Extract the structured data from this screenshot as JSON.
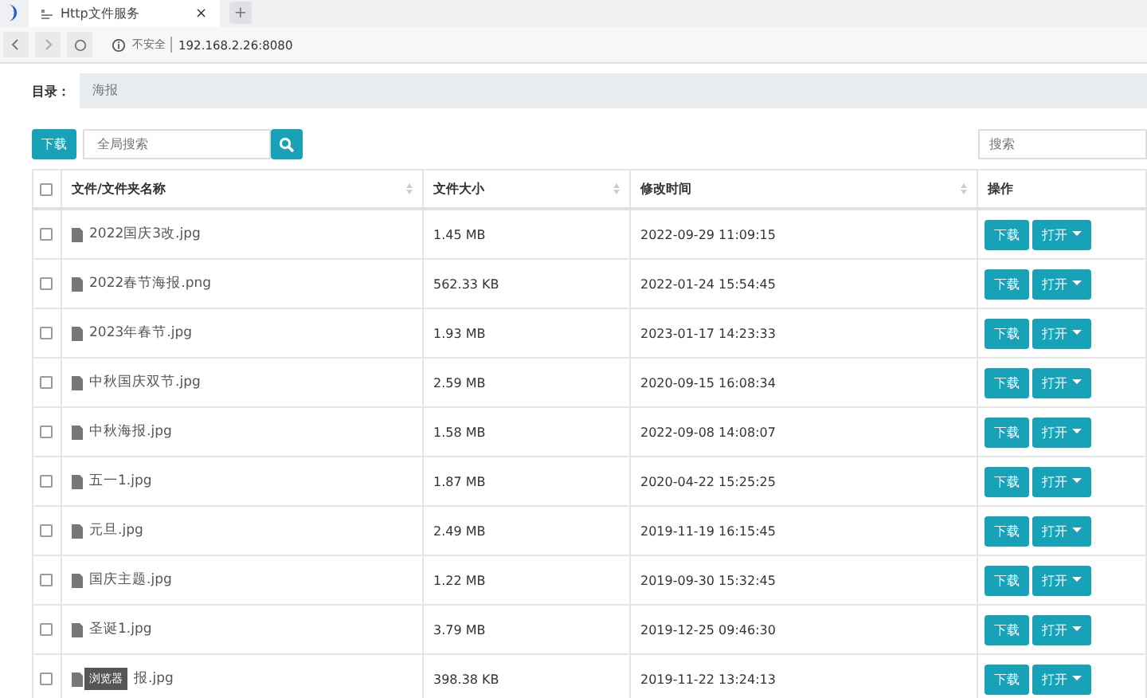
{
  "browser": {
    "tab": {
      "title": "Http文件服务",
      "close": "×"
    },
    "new_tab": "+",
    "security": "不安全",
    "address": "192.168.2.26:8080"
  },
  "directory": {
    "label": "目录：",
    "path": "海报"
  },
  "toolbar": {
    "download": "下载",
    "global_search_placeholder": "全局搜索",
    "search_placeholder": "搜索"
  },
  "table": {
    "header_checked": false,
    "columns": [
      {
        "label": "文件/文件夹名称",
        "sortable": true
      },
      {
        "label": "文件大小",
        "sortable": true
      },
      {
        "label": "修改时间",
        "sortable": true
      },
      {
        "label": "操作",
        "sortable": false
      }
    ],
    "rows": [
      {
        "checked": false,
        "name": "2022国庆3改.jpg",
        "size": "1.45 MB",
        "modified": "2022-09-29 11:09:15",
        "download": "下载",
        "open": "打开"
      },
      {
        "checked": false,
        "name": "2022春节海报.png",
        "size": "562.33 KB",
        "modified": "2022-01-24 15:54:45",
        "download": "下载",
        "open": "打开"
      },
      {
        "checked": false,
        "name": "2023年春节.jpg",
        "size": "1.93 MB",
        "modified": "2023-01-17 14:23:33",
        "download": "下载",
        "open": "打开"
      },
      {
        "checked": false,
        "name": "中秋国庆双节.jpg",
        "size": "2.59 MB",
        "modified": "2020-09-15 16:08:34",
        "download": "下载",
        "open": "打开"
      },
      {
        "checked": false,
        "name": "中秋海报.jpg",
        "size": "1.58 MB",
        "modified": "2022-09-08 14:08:07",
        "download": "下载",
        "open": "打开"
      },
      {
        "checked": false,
        "name": "五一1.jpg",
        "size": "1.87 MB",
        "modified": "2020-04-22 15:25:25",
        "download": "下载",
        "open": "打开"
      },
      {
        "checked": false,
        "name": "元旦.jpg",
        "size": "2.49 MB",
        "modified": "2019-11-19 16:15:45",
        "download": "下载",
        "open": "打开"
      },
      {
        "checked": false,
        "name": "国庆主题.jpg",
        "size": "1.22 MB",
        "modified": "2019-09-30 15:32:45",
        "download": "下载",
        "open": "打开"
      },
      {
        "checked": false,
        "name": "圣诞1.jpg",
        "size": "3.79 MB",
        "modified": "2019-12-25 09:46:30",
        "download": "下载",
        "open": "打开"
      },
      {
        "checked": false,
        "tooltip": "浏览器",
        "name": "报.jpg",
        "size": "398.38 KB",
        "modified": "2019-11-22 13:24:13",
        "download": "下载",
        "open": "打开"
      }
    ]
  }
}
